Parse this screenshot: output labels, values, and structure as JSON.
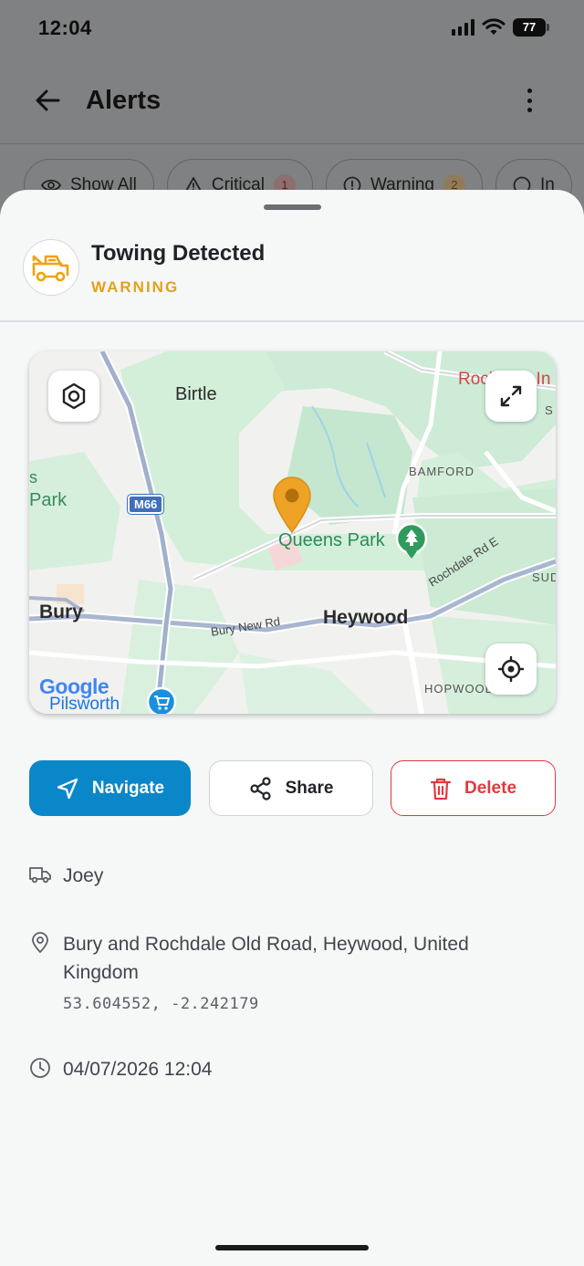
{
  "status_bar": {
    "time": "12:04",
    "battery": "77"
  },
  "app_bar": {
    "title": "Alerts"
  },
  "filters": [
    {
      "label": "Show All",
      "count": ""
    },
    {
      "label": "Critical",
      "count": "1"
    },
    {
      "label": "Warning",
      "count": "2"
    },
    {
      "label": "In",
      "count": ""
    }
  ],
  "alert": {
    "title": "Towing Detected",
    "level": "WARNING",
    "level_color": "#e2a11b"
  },
  "map": {
    "labels": {
      "birtle": "Birtle",
      "rochdale": "Rochdale In",
      "s_edge": "S",
      "bamford": "BAMFORD",
      "park": "Park",
      "s_left": "s",
      "m66": "M66",
      "queens_park": "Queens Park",
      "rochdale_rd": "Rochdale Rd E",
      "sud": "SUD",
      "bury": "Bury",
      "bury_new_rd": "Bury New Rd",
      "heywood": "Heywood",
      "hopwood": "HOPWOOD",
      "google": "Google",
      "pilsworth": "Pilsworth"
    }
  },
  "actions": {
    "navigate": "Navigate",
    "share": "Share",
    "delete": "Delete"
  },
  "details": {
    "vehicle": "Joey",
    "address_line1": "Bury and Rochdale Old Road, Heywood, United",
    "address_line2": "Kingdom",
    "coordinates": "53.604552, -2.242179",
    "datetime": "04/07/2026 12:04"
  },
  "colors": {
    "primary": "#0a87c9",
    "danger": "#e0393e",
    "warning": "#e2a11b"
  }
}
